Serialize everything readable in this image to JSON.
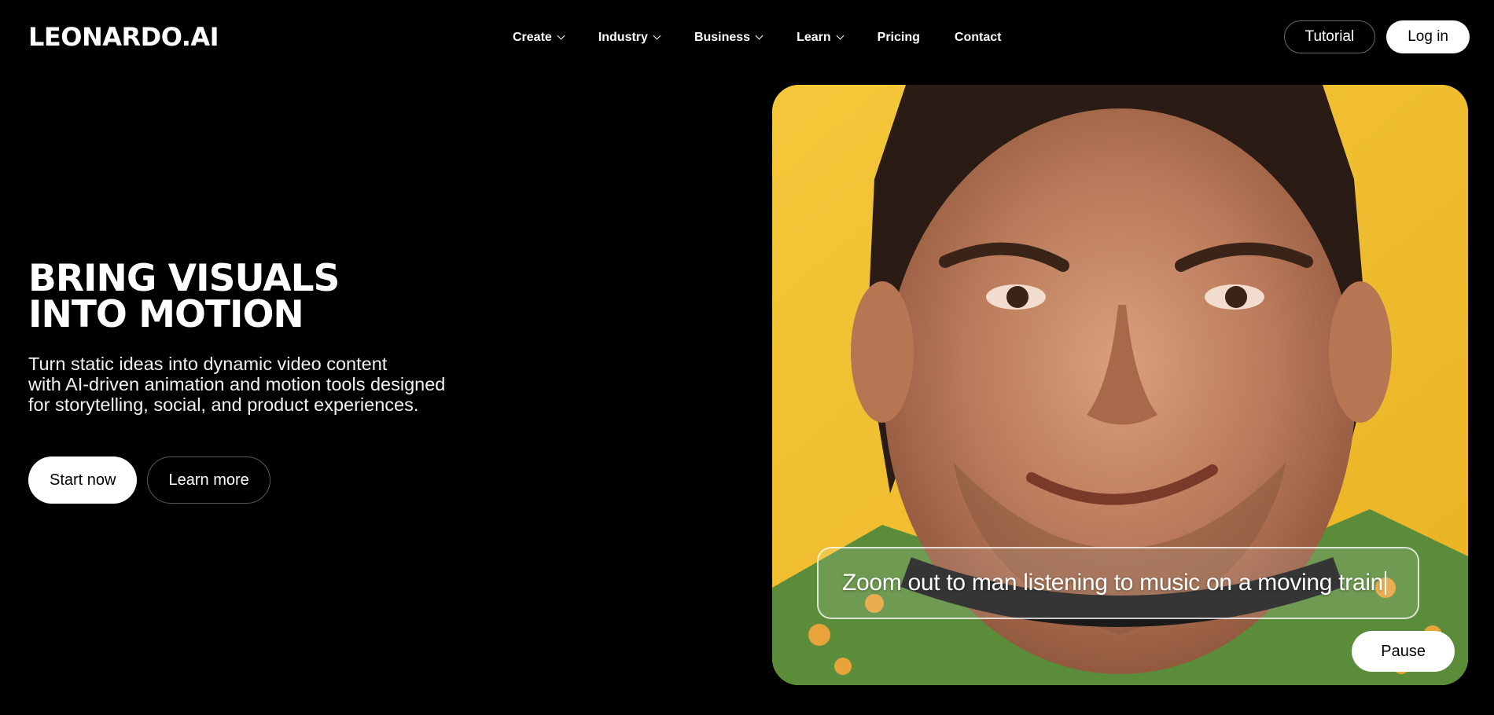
{
  "header": {
    "logo": "LEONARDO.AI",
    "nav": [
      {
        "label": "Create",
        "has_dropdown": true
      },
      {
        "label": "Industry",
        "has_dropdown": true
      },
      {
        "label": "Business",
        "has_dropdown": true
      },
      {
        "label": "Learn",
        "has_dropdown": true
      },
      {
        "label": "Pricing",
        "has_dropdown": false
      },
      {
        "label": "Contact",
        "has_dropdown": false
      }
    ],
    "tutorial_label": "Tutorial",
    "login_label": "Log in"
  },
  "hero": {
    "title_lines": [
      "BRING VISUALS",
      "INTO MOTION"
    ],
    "subtitle_lines": [
      "Turn static ideas into dynamic video content",
      "with AI-driven animation and motion tools designed",
      "for storytelling, social, and product experiences."
    ],
    "start_label": "Start now",
    "learn_label": "Learn more"
  },
  "media": {
    "prompt_text": "Zoom out to man listening to music on a moving train",
    "pause_label": "Pause",
    "background_color": "#f2c12e"
  },
  "icons": {
    "dropdown": "chevron-down-icon",
    "caret": "text-cursor-icon"
  },
  "colors": {
    "background": "#000000",
    "text": "#ffffff",
    "button_fill": "#ffffff",
    "accent_yellow": "#f2c12e"
  }
}
